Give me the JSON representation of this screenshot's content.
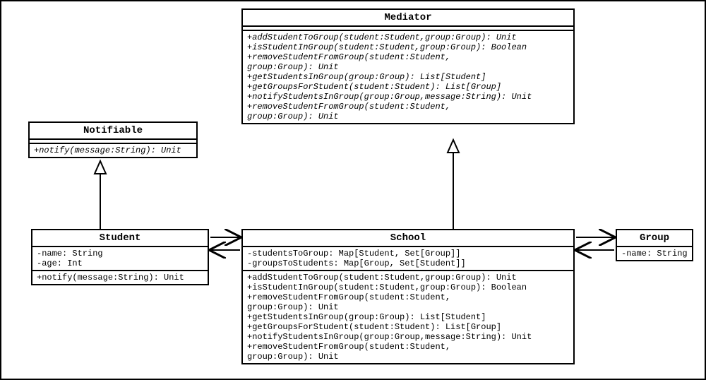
{
  "classes": {
    "notifiable": {
      "name": "Notifiable",
      "methods": "+notify(message:String): Unit"
    },
    "mediator": {
      "name": "Mediator",
      "methods": "+addStudentToGroup(student:Student,group:Group): Unit\n+isStudentInGroup(student:Student,group:Group): Boolean\n+removeStudentFromGroup(student:Student,\ngroup:Group): Unit\n+getStudentsInGroup(group:Group): List[Student]\n+getGroupsForStudent(student:Student): List[Group]\n+notifyStudentsInGroup(group:Group,message:String): Unit\n+removeStudentFromGroup(student:Student,\ngroup:Group): Unit"
    },
    "student": {
      "name": "Student",
      "attrs": "-name: String\n-age: Int",
      "methods": "+notify(message:String): Unit"
    },
    "school": {
      "name": "School",
      "attrs": "-studentsToGroup: Map[Student, Set[Group]]\n-groupsToStudents: Map[Group, Set[Student]]",
      "methods": "+addStudentToGroup(student:Student,group:Group): Unit\n+isStudentInGroup(student:Student,group:Group): Boolean\n+removeStudentFromGroup(student:Student,\ngroup:Group): Unit\n+getStudentsInGroup(group:Group): List[Student]\n+getGroupsForStudent(student:Student): List[Group]\n+notifyStudentsInGroup(group:Group,message:String): Unit\n+removeStudentFromGroup(student:Student,\ngroup:Group): Unit"
    },
    "group": {
      "name": "Group",
      "attrs": "-name: String"
    }
  },
  "relations": [
    {
      "from": "Student",
      "to": "Notifiable",
      "type": "realization"
    },
    {
      "from": "School",
      "to": "Mediator",
      "type": "realization"
    },
    {
      "from": "School",
      "to": "Student",
      "type": "association",
      "bidirectional": true
    },
    {
      "from": "School",
      "to": "Group",
      "type": "association",
      "bidirectional": true
    }
  ]
}
